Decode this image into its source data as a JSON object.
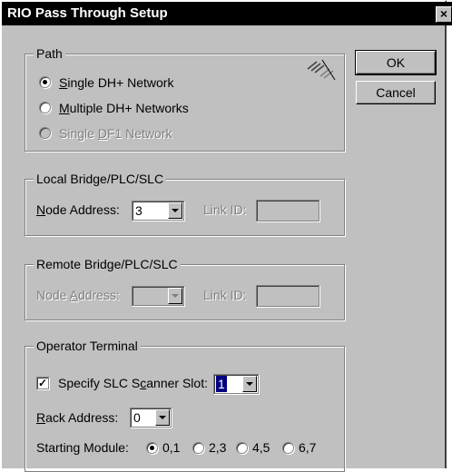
{
  "dialog": {
    "title": "RIO Pass Through Setup",
    "close_label": "×"
  },
  "buttons": {
    "ok": "OK",
    "cancel": "Cancel"
  },
  "path": {
    "legend": "Path",
    "options": [
      {
        "label": "Single DH+ Network",
        "selected": true,
        "enabled": true
      },
      {
        "label": "Multiple DH+ Networks",
        "selected": false,
        "enabled": true
      },
      {
        "label": "Single DF1 Network",
        "selected": false,
        "enabled": false
      }
    ]
  },
  "local": {
    "legend": "Local Bridge/PLC/SLC",
    "node_label": "Node Address:",
    "node_value": "3",
    "link_label": "Link ID:",
    "link_value": ""
  },
  "remote": {
    "legend": "Remote Bridge/PLC/SLC",
    "node_label": "Node Address:",
    "node_value": "",
    "link_label": "Link ID:",
    "link_value": ""
  },
  "operator": {
    "legend": "Operator Terminal",
    "scanner_label": "Specify SLC Scanner Slot:",
    "scanner_checked": true,
    "scanner_value": "1",
    "rack_label": "Rack Address:",
    "rack_value": "0",
    "start_label": "Starting Module:",
    "start_options": [
      "0,1",
      "2,3",
      "4,5",
      "6,7"
    ],
    "start_selected": 0
  },
  "icons": {
    "network": "network-link-icon",
    "dropdown": "chevron-down-icon"
  }
}
